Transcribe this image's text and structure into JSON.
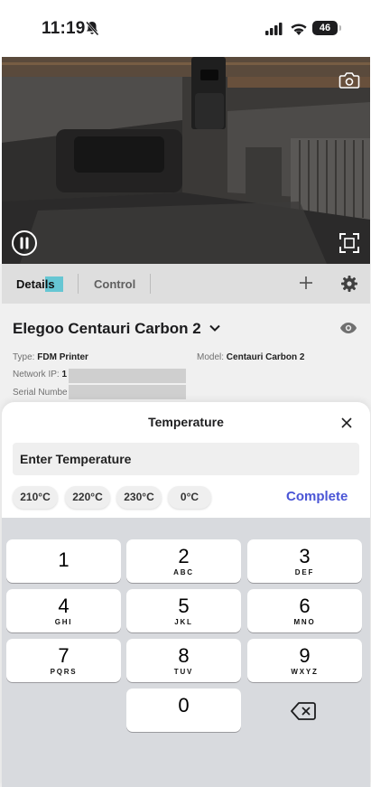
{
  "status_bar": {
    "time": "11:19",
    "battery": "46"
  },
  "tabs": [
    {
      "label": "Details"
    },
    {
      "label": "Control"
    }
  ],
  "printer": {
    "name": "Elegoo Centauri Carbon 2",
    "type_label": "Type:",
    "type_value": "FDM Printer",
    "model_label": "Model:",
    "model_value": "Centauri Carbon 2",
    "network_label": "Network IP:",
    "network_value": "1",
    "serial_label": "Serial Numbe"
  },
  "sheet": {
    "title": "Temperature",
    "input_placeholder": "Enter Temperature",
    "presets": [
      "210°C",
      "220°C",
      "230°C",
      "0°C"
    ],
    "complete_label": "Complete"
  },
  "keypad": {
    "keys": [
      {
        "digit": "1",
        "letters": ""
      },
      {
        "digit": "2",
        "letters": "ABC"
      },
      {
        "digit": "3",
        "letters": "DEF"
      },
      {
        "digit": "4",
        "letters": "GHI"
      },
      {
        "digit": "5",
        "letters": "JKL"
      },
      {
        "digit": "6",
        "letters": "MNO"
      },
      {
        "digit": "7",
        "letters": "PQRS"
      },
      {
        "digit": "8",
        "letters": "TUV"
      },
      {
        "digit": "9",
        "letters": "WXYZ"
      },
      {
        "digit": "0",
        "letters": ""
      }
    ]
  },
  "icons": {
    "silent_bell": "bell-slash-icon",
    "signal": "cellular-signal-icon",
    "wifi": "wifi-icon",
    "pause": "pause-icon",
    "fullscreen": "fullscreen-icon",
    "snapshot": "camera-snapshot-icon",
    "add": "plus-icon",
    "settings": "gear-icon",
    "visibility": "eye-icon",
    "close": "close-icon",
    "backspace": "backspace-icon"
  },
  "colors": {
    "accent": "#4a55d6",
    "tab_highlight": "#5fd0e0",
    "keypad_bg": "#d8dade"
  }
}
